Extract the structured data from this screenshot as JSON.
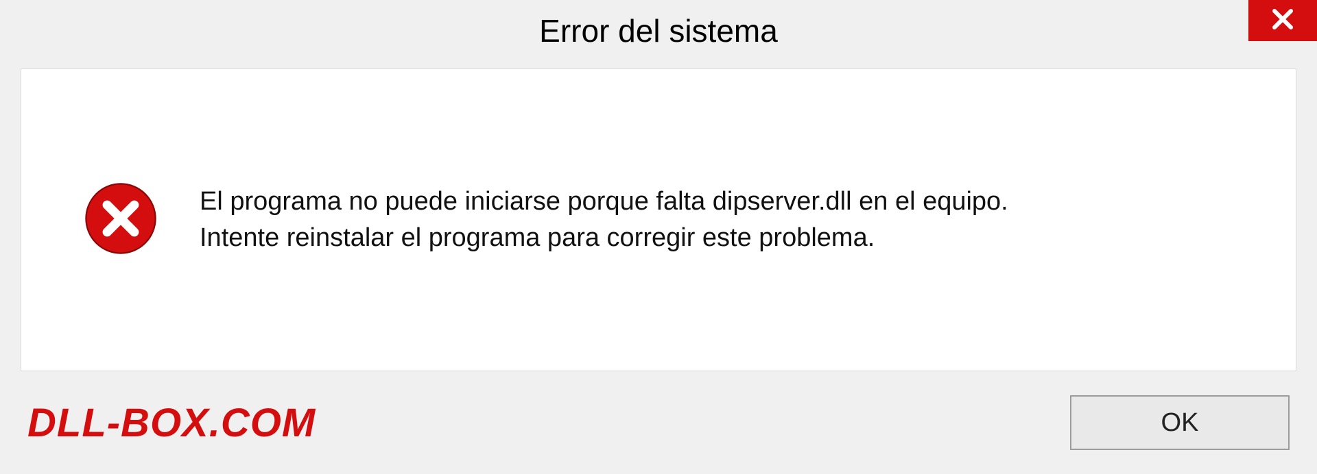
{
  "titlebar": {
    "title": "Error del sistema"
  },
  "message": {
    "line1": "El programa no puede iniciarse porque falta dipserver.dll en el equipo.",
    "line2": "Intente reinstalar el programa para corregir este problema."
  },
  "footer": {
    "watermark": "DLL-BOX.COM",
    "ok_label": "OK"
  },
  "colors": {
    "accent_red": "#d40e0e",
    "panel_bg": "#ffffff",
    "body_bg": "#f0f0f0"
  }
}
